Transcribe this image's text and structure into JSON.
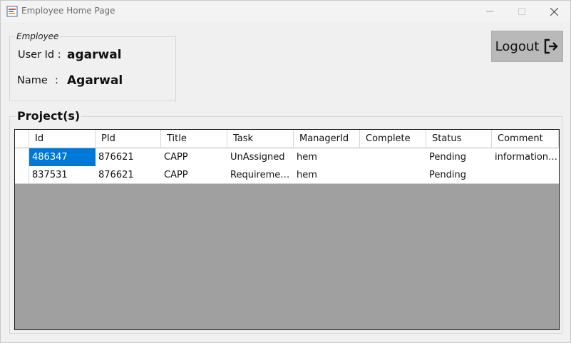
{
  "window": {
    "title": "Employee Home Page",
    "minimize_glyph": "—",
    "maximize_glyph": "☐",
    "close_glyph": "✕",
    "app_icon": "chart-app-icon"
  },
  "employee": {
    "legend": "Employee",
    "user_id_label": "User Id :",
    "user_id_value": "agarwal",
    "name_label": "Name",
    "name_colon": ":",
    "name_value": "Agarwal"
  },
  "logout": {
    "label": "Logout",
    "icon": "logout-arrow-icon"
  },
  "projects": {
    "legend": "Project(s)",
    "columns": [
      "Id",
      "PId",
      "Title",
      "Task",
      "ManagerId",
      "Complete",
      "Status",
      "Comment"
    ],
    "rows": [
      [
        "486347",
        "876621",
        "CAPP",
        "UnAssigned",
        "hem",
        "",
        "Pending",
        "information ..."
      ],
      [
        "837531",
        "876621",
        "CAPP",
        "Requiremen...",
        "hem",
        "",
        "Pending",
        ""
      ]
    ],
    "selected_cell": "486347"
  },
  "colors": {
    "selection": "#0078d7",
    "grid_background": "#a0a0a0",
    "logout_button": "#b9b9b9"
  }
}
